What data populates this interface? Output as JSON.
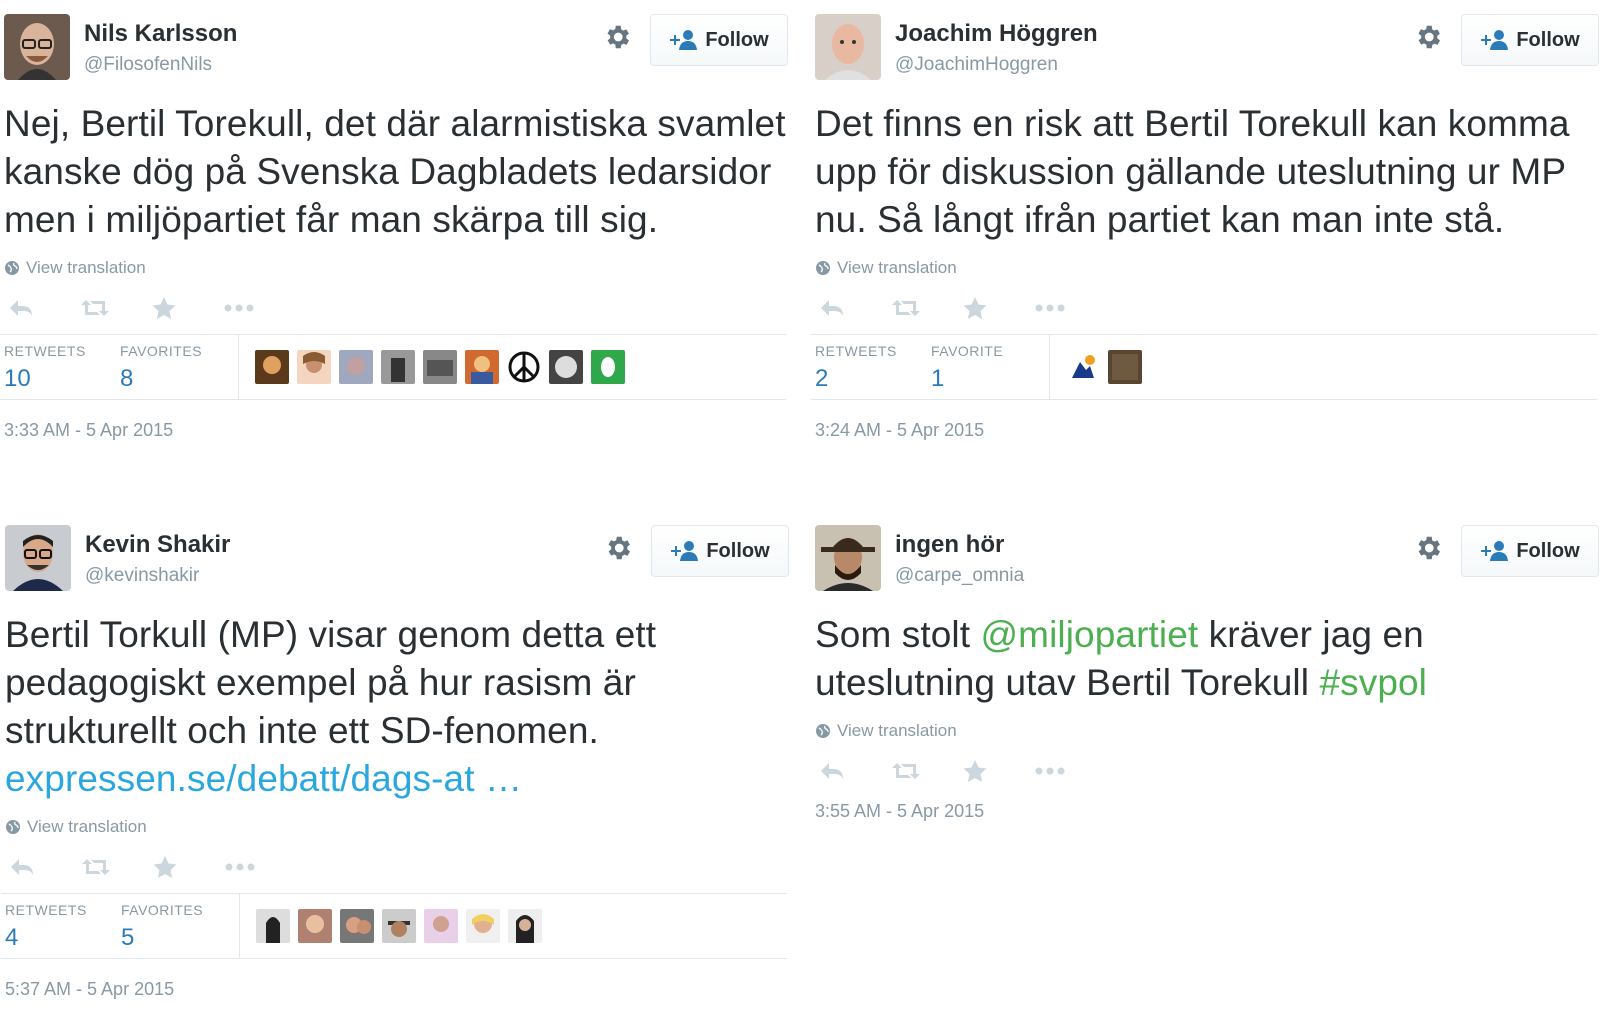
{
  "tweets": [
    {
      "name": "Nils Karlsson",
      "handle": "@FilosofenNils",
      "follow_label": "Follow",
      "text": "Nej, Bertil Torekull, det där alarmistiska svamlet kanske dög på Svenska Dagbladets ledarsidor men i miljöpartiet får man skärpa till sig.",
      "translate_label": "View translation",
      "retweets_label": "RETWEETS",
      "retweets": "10",
      "favorites_label": "FAVORITES",
      "favorites": "8",
      "timestamp": "3:33 AM - 5 Apr 2015"
    },
    {
      "name": "Joachim Höggren",
      "handle": "@JoachimHoggren",
      "follow_label": "Follow",
      "text": "Det finns en risk att Bertil Torekull kan komma upp för diskussion gällande uteslutning ur MP nu. Så långt ifrån partiet kan man inte stå.",
      "translate_label": "View translation",
      "retweets_label": "RETWEETS",
      "retweets": "2",
      "favorites_label": "FAVORITE",
      "favorites": "1",
      "timestamp": "3:24 AM - 5 Apr 2015"
    },
    {
      "name": "Kevin Shakir",
      "handle": "@kevinshakir",
      "follow_label": "Follow",
      "text": "Bertil Torkull (MP) visar genom detta ett pedagogiskt exempel på hur rasism är strukturellt och inte ett SD-fenomen.",
      "link": "expressen.se/debatt/dags-at …",
      "translate_label": "View translation",
      "retweets_label": "RETWEETS",
      "retweets": "4",
      "favorites_label": "FAVORITES",
      "favorites": "5",
      "timestamp": "5:37 AM - 5 Apr 2015"
    },
    {
      "name": "ingen hör",
      "handle": "@carpe_omnia",
      "follow_label": "Follow",
      "text_before": "Som stolt ",
      "mention": "@miljopartiet",
      "text_middle": " kräver jag en uteslutning utav Bertil Torekull ",
      "hashtag": "#svpol",
      "translate_label": "View translation",
      "timestamp": "3:55 AM - 5 Apr 2015"
    }
  ],
  "colors": {
    "link": "#2ba7df",
    "hashtag": "#4caf50",
    "stat_value": "#2b7bb9",
    "muted": "#8899a6"
  },
  "icons": [
    "gear-icon",
    "follow-person-icon",
    "globe-icon",
    "reply-icon",
    "retweet-icon",
    "favorite-star-icon",
    "more-icon"
  ]
}
